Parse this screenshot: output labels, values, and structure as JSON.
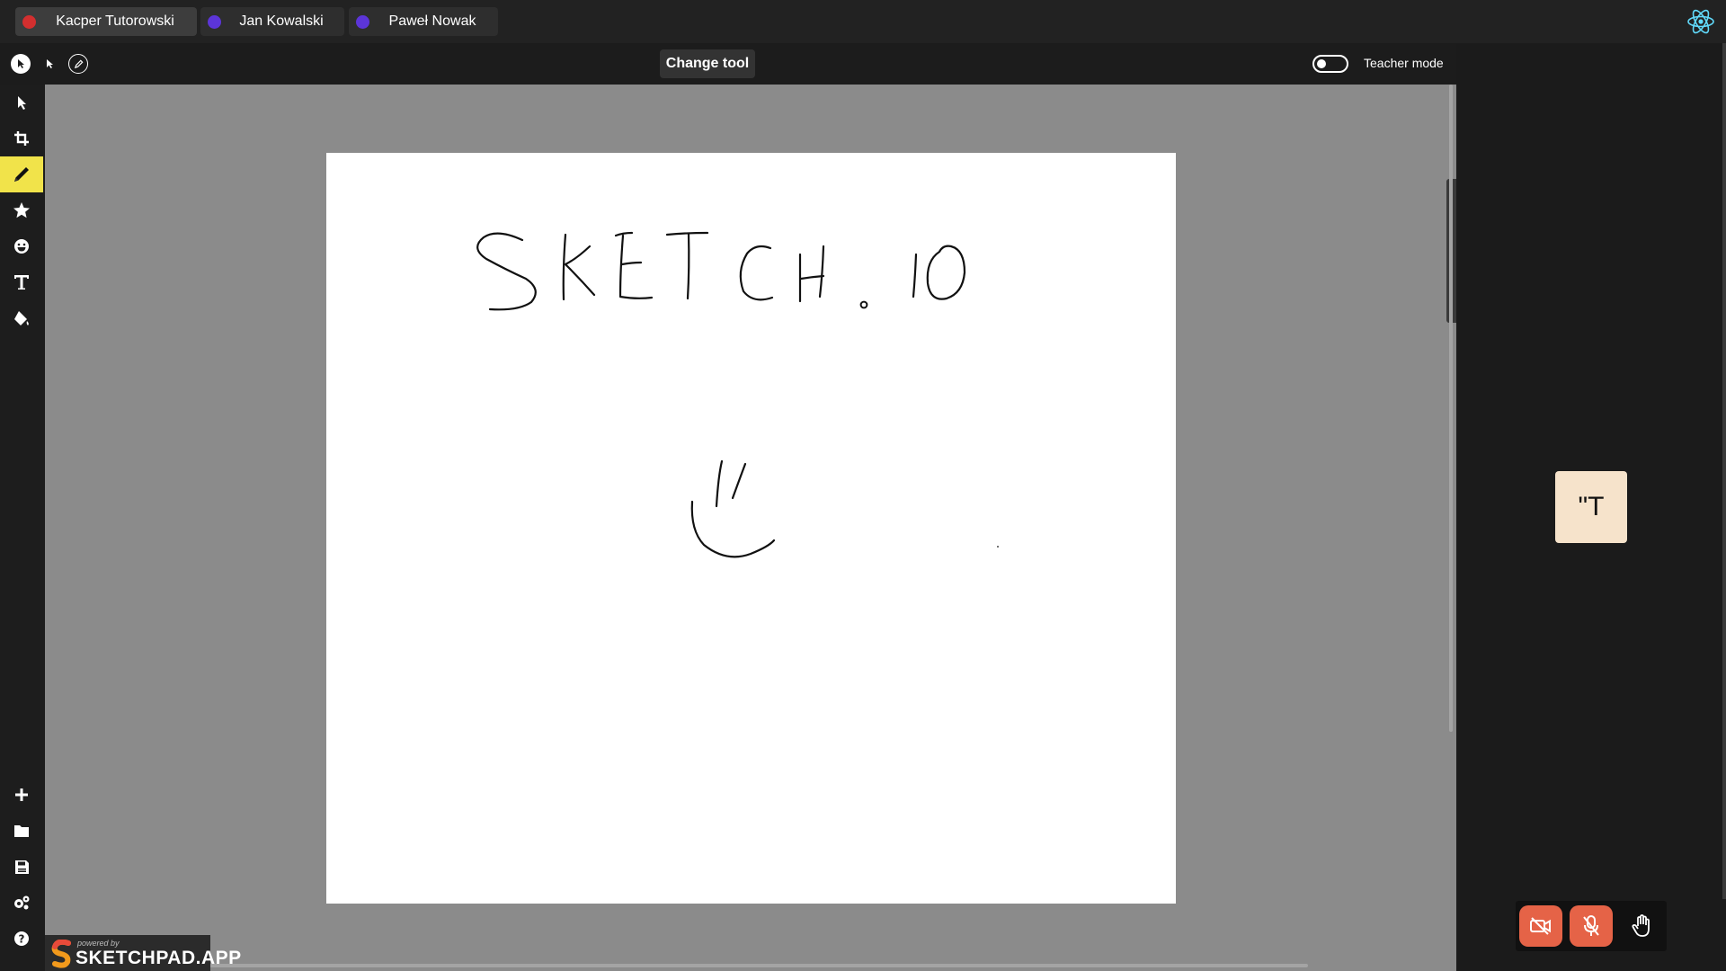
{
  "topbar": {
    "users": [
      {
        "name": "Kacper Tutorowski",
        "dot_color": "#d32f2f",
        "active": true
      },
      {
        "name": "Jan Kowalski",
        "dot_color": "#5c35d8",
        "active": false
      },
      {
        "name": "Paweł Nowak",
        "dot_color": "#5c35d8",
        "active": false
      }
    ],
    "logo_icon": "react-icon"
  },
  "toolbar": {
    "change_tool_label": "Change tool",
    "teacher_mode_label": "Teacher mode",
    "teacher_mode_enabled": false,
    "mini_tools": [
      "pointer-filled-icon",
      "pointer-icon",
      "pencil-outline-icon"
    ]
  },
  "sidebar": {
    "top_tools": [
      "select-icon",
      "crop-icon",
      "pencil-icon",
      "star-icon",
      "emoji-icon",
      "text-icon",
      "fill-icon"
    ],
    "active_tool": "pencil-icon",
    "active_color": "#f1e34a",
    "bottom_tools": [
      "add-icon",
      "folder-icon",
      "save-icon",
      "settings-icon",
      "help-icon"
    ]
  },
  "canvas": {
    "drawing": "SKETCH.IO handwritten text with a smile sketch"
  },
  "right_tools": [
    "layers-icon",
    "search-icon",
    "history-icon",
    "undo-icon"
  ],
  "branding": {
    "powered_by": "powered by",
    "name": "SKETCHPAD.APP"
  },
  "video": {
    "tile_text": "\"T",
    "tile_color": "#f6e3cb",
    "controls": [
      "camera-off-icon",
      "mic-off-icon",
      "raise-hand-icon"
    ],
    "control_color": "#e56347"
  }
}
